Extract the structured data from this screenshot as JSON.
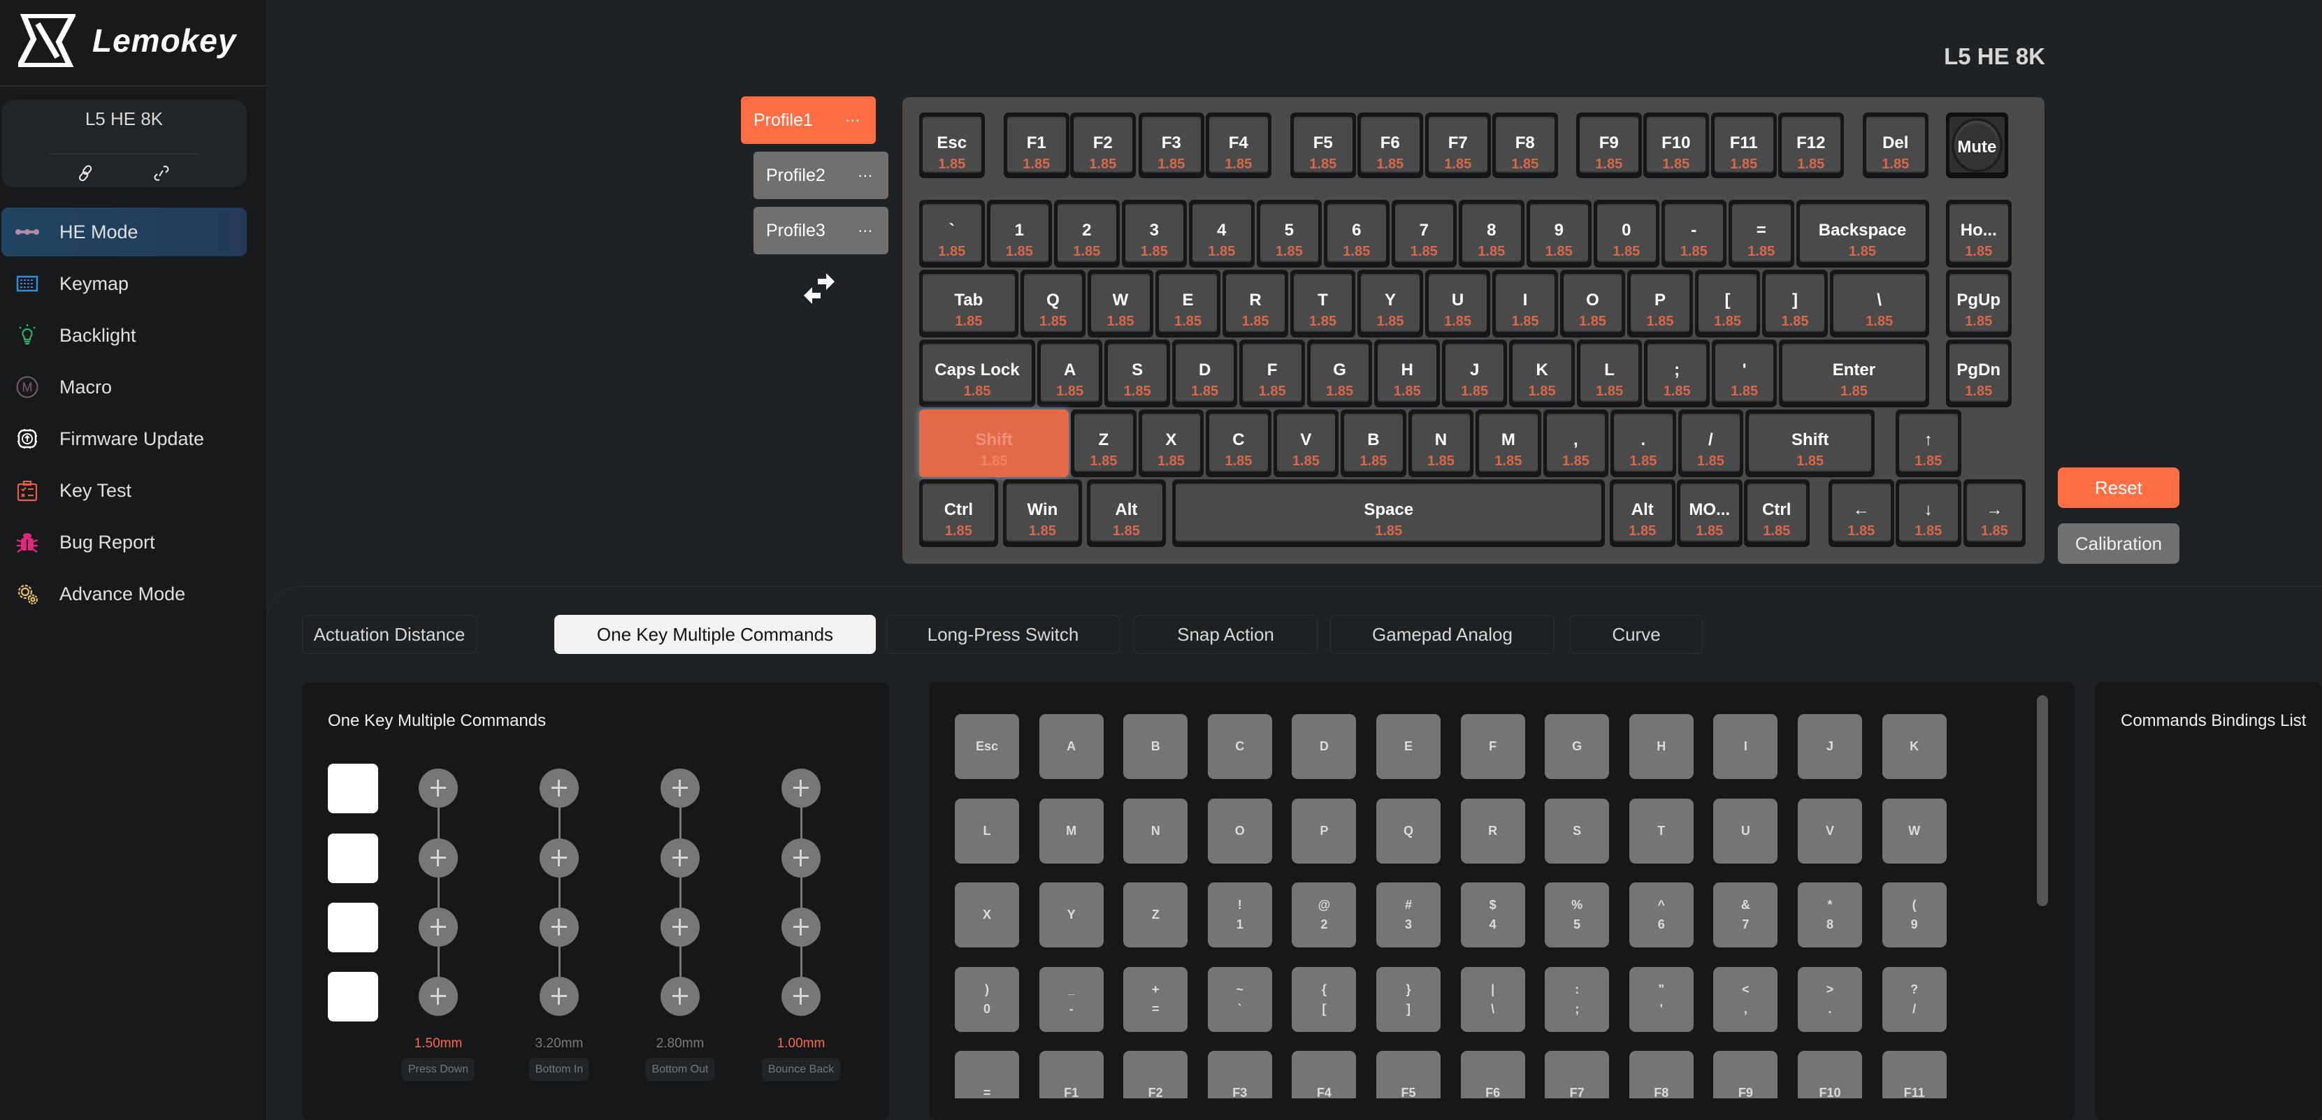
{
  "app": {
    "brand": "Lemokey",
    "device_title": "L5 HE 8K",
    "accent_color": "#ff6f43",
    "key_value_color": "#d9684a"
  },
  "sidebar": {
    "device_card": {
      "name": "L5 HE 8K",
      "link_icons": [
        "link-icon",
        "unlink-icon"
      ]
    },
    "items": [
      {
        "label": "HE Mode",
        "icon": "he-mode-icon",
        "active": true
      },
      {
        "label": "Keymap",
        "icon": "keymap-icon",
        "active": false
      },
      {
        "label": "Backlight",
        "icon": "lightbulb-icon",
        "active": false
      },
      {
        "label": "Macro",
        "icon": "macro-icon",
        "active": false
      },
      {
        "label": "Firmware Update",
        "icon": "firmware-upload-icon",
        "active": false
      },
      {
        "label": "Key Test",
        "icon": "checklist-icon",
        "active": false
      },
      {
        "label": "Bug Report",
        "icon": "bug-icon",
        "active": false
      },
      {
        "label": "Advance Mode",
        "icon": "gears-icon",
        "active": false
      }
    ]
  },
  "profiles": [
    {
      "name": "Profile1",
      "more": "...",
      "active": true
    },
    {
      "name": "Profile2",
      "more": "...",
      "active": false
    },
    {
      "name": "Profile3",
      "more": "...",
      "active": false
    }
  ],
  "keyboard": {
    "selected_key": "Shift",
    "rows": [
      [
        [
          "Esc",
          "1.85"
        ],
        [
          "F1",
          "1.85"
        ],
        [
          "F2",
          "1.85"
        ],
        [
          "F3",
          "1.85"
        ],
        [
          "F4",
          "1.85"
        ],
        [
          "F5",
          "1.85"
        ],
        [
          "F6",
          "1.85"
        ],
        [
          "F7",
          "1.85"
        ],
        [
          "F8",
          "1.85"
        ],
        [
          "F9",
          "1.85"
        ],
        [
          "F10",
          "1.85"
        ],
        [
          "F11",
          "1.85"
        ],
        [
          "F12",
          "1.85"
        ],
        [
          "Del",
          "1.85"
        ],
        [
          "Mute",
          ""
        ]
      ],
      [
        [
          "`",
          "1.85"
        ],
        [
          "1",
          "1.85"
        ],
        [
          "2",
          "1.85"
        ],
        [
          "3",
          "1.85"
        ],
        [
          "4",
          "1.85"
        ],
        [
          "5",
          "1.85"
        ],
        [
          "6",
          "1.85"
        ],
        [
          "7",
          "1.85"
        ],
        [
          "8",
          "1.85"
        ],
        [
          "9",
          "1.85"
        ],
        [
          "0",
          "1.85"
        ],
        [
          "-",
          "1.85"
        ],
        [
          "=",
          "1.85"
        ],
        [
          "Backspace",
          "1.85"
        ],
        [
          "Ho...",
          "1.85"
        ]
      ],
      [
        [
          "Tab",
          "1.85"
        ],
        [
          "Q",
          "1.85"
        ],
        [
          "W",
          "1.85"
        ],
        [
          "E",
          "1.85"
        ],
        [
          "R",
          "1.85"
        ],
        [
          "T",
          "1.85"
        ],
        [
          "Y",
          "1.85"
        ],
        [
          "U",
          "1.85"
        ],
        [
          "I",
          "1.85"
        ],
        [
          "O",
          "1.85"
        ],
        [
          "P",
          "1.85"
        ],
        [
          "[",
          "1.85"
        ],
        [
          "]",
          "1.85"
        ],
        [
          "\\",
          "1.85"
        ],
        [
          "PgUp",
          "1.85"
        ]
      ],
      [
        [
          "Caps Lock",
          "1.85"
        ],
        [
          "A",
          "1.85"
        ],
        [
          "S",
          "1.85"
        ],
        [
          "D",
          "1.85"
        ],
        [
          "F",
          "1.85"
        ],
        [
          "G",
          "1.85"
        ],
        [
          "H",
          "1.85"
        ],
        [
          "J",
          "1.85"
        ],
        [
          "K",
          "1.85"
        ],
        [
          "L",
          "1.85"
        ],
        [
          ";",
          "1.85"
        ],
        [
          "'",
          "1.85"
        ],
        [
          "Enter",
          "1.85"
        ],
        [
          "PgDn",
          "1.85"
        ]
      ],
      [
        [
          "Shift",
          "1.85"
        ],
        [
          "Z",
          "1.85"
        ],
        [
          "X",
          "1.85"
        ],
        [
          "C",
          "1.85"
        ],
        [
          "V",
          "1.85"
        ],
        [
          "B",
          "1.85"
        ],
        [
          "N",
          "1.85"
        ],
        [
          "M",
          "1.85"
        ],
        [
          ",",
          "1.85"
        ],
        [
          ".",
          "1.85"
        ],
        [
          "/",
          "1.85"
        ],
        [
          "Shift",
          "1.85"
        ],
        [
          "↑",
          "1.85"
        ]
      ],
      [
        [
          "Ctrl",
          "1.85"
        ],
        [
          "Win",
          "1.85"
        ],
        [
          "Alt",
          "1.85"
        ],
        [
          "Space",
          "1.85"
        ],
        [
          "Alt",
          "1.85"
        ],
        [
          "MO...",
          "1.85"
        ],
        [
          "Ctrl",
          "1.85"
        ],
        [
          "←",
          "1.85"
        ],
        [
          "↓",
          "1.85"
        ],
        [
          "→",
          "1.85"
        ]
      ]
    ]
  },
  "actions": {
    "reset": "Reset",
    "calibration": "Calibration"
  },
  "tabs": [
    {
      "label": "Actuation Distance",
      "active": false
    },
    {
      "label": "One Key Multiple Commands",
      "active": true
    },
    {
      "label": "Long-Press Switch",
      "active": false
    },
    {
      "label": "Snap Action",
      "active": false
    },
    {
      "label": "Gamepad Analog",
      "active": false
    },
    {
      "label": "Curve",
      "active": false
    }
  ],
  "okmc": {
    "title": "One Key Multiple Commands",
    "slots": 4,
    "stages": [
      {
        "distance": "1.50mm",
        "label": "Press Down",
        "highlight": true
      },
      {
        "distance": "3.20mm",
        "label": "Bottom In",
        "highlight": false
      },
      {
        "distance": "2.80mm",
        "label": "Bottom Out",
        "highlight": false
      },
      {
        "distance": "1.00mm",
        "label": "Bounce Back",
        "highlight": true
      }
    ]
  },
  "picker": {
    "rows": [
      [
        [
          "",
          "Esc",
          ""
        ],
        [
          "",
          "A",
          ""
        ],
        [
          "",
          "B",
          ""
        ],
        [
          "",
          "C",
          ""
        ],
        [
          "",
          "D",
          ""
        ],
        [
          "",
          "E",
          ""
        ],
        [
          "",
          "F",
          ""
        ],
        [
          "",
          "G",
          ""
        ],
        [
          "",
          "H",
          ""
        ],
        [
          "",
          "I",
          ""
        ],
        [
          "",
          "J",
          ""
        ],
        [
          "",
          "K",
          ""
        ]
      ],
      [
        [
          "",
          "L",
          ""
        ],
        [
          "",
          "M",
          ""
        ],
        [
          "",
          "N",
          ""
        ],
        [
          "",
          "O",
          ""
        ],
        [
          "",
          "P",
          ""
        ],
        [
          "",
          "Q",
          ""
        ],
        [
          "",
          "R",
          ""
        ],
        [
          "",
          "S",
          ""
        ],
        [
          "",
          "T",
          ""
        ],
        [
          "",
          "U",
          ""
        ],
        [
          "",
          "V",
          ""
        ],
        [
          "",
          "W",
          ""
        ]
      ],
      [
        [
          "",
          "X",
          ""
        ],
        [
          "",
          "Y",
          ""
        ],
        [
          "",
          "Z",
          ""
        ],
        [
          "!",
          "",
          "1"
        ],
        [
          "@",
          "",
          "2"
        ],
        [
          "#",
          "",
          "3"
        ],
        [
          "$",
          "",
          "4"
        ],
        [
          "%",
          "",
          "5"
        ],
        [
          "^",
          "",
          "6"
        ],
        [
          "&",
          "",
          "7"
        ],
        [
          "*",
          "",
          "8"
        ],
        [
          "(",
          "",
          "9"
        ]
      ],
      [
        [
          ")",
          "",
          "0"
        ],
        [
          "_",
          "",
          "-"
        ],
        [
          "+",
          "",
          "="
        ],
        [
          "~",
          "",
          "`"
        ],
        [
          "{",
          "",
          "["
        ],
        [
          "}",
          "",
          "]"
        ],
        [
          "|",
          "",
          "\\"
        ],
        [
          ":",
          "",
          ";"
        ],
        [
          "\"",
          "",
          "'"
        ],
        [
          "<",
          "",
          ","
        ],
        [
          ">",
          "",
          "."
        ],
        [
          "?",
          "",
          "/"
        ]
      ],
      [
        [
          "",
          "",
          "="
        ],
        [
          "",
          "",
          "F1"
        ],
        [
          "",
          "",
          "F2"
        ],
        [
          "",
          "",
          "F3"
        ],
        [
          "",
          "",
          "F4"
        ],
        [
          "",
          "",
          "F5"
        ],
        [
          "",
          "",
          "F6"
        ],
        [
          "",
          "",
          "F7"
        ],
        [
          "",
          "",
          "F8"
        ],
        [
          "",
          "",
          "F9"
        ],
        [
          "",
          "",
          "F10"
        ],
        [
          "",
          "",
          "F11"
        ]
      ]
    ]
  },
  "bindings": {
    "title": "Commands Bindings List"
  }
}
